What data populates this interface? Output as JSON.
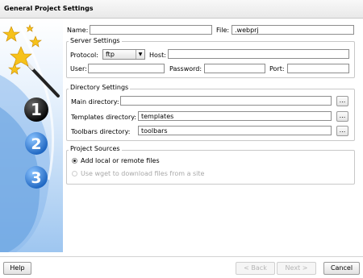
{
  "window": {
    "title": "General Project Settings"
  },
  "project": {
    "name_label": "Name:",
    "name_value": "",
    "file_label": "File:",
    "file_value": ".webprj"
  },
  "server": {
    "legend": "Server Settings",
    "protocol_label": "Protocol:",
    "protocol_value": "ftp",
    "host_label": "Host:",
    "host_value": "",
    "user_label": "User:",
    "user_value": "",
    "password_label": "Password:",
    "password_value": "",
    "port_label": "Port:",
    "port_value": ""
  },
  "directories": {
    "legend": "Directory Settings",
    "main_label": "Main directory:",
    "main_value": "",
    "templates_label": "Templates directory:",
    "templates_value": "templates",
    "toolbars_label": "Toolbars directory:",
    "toolbars_value": "toolbars",
    "browse_label": "..."
  },
  "sources": {
    "legend": "Project Sources",
    "option_local": "Add local or remote files",
    "option_wget": "Use wget to download files from a site"
  },
  "steps": [
    "1",
    "2",
    "3"
  ],
  "buttons": {
    "help": "Help",
    "back": "< Back",
    "next": "Next >",
    "cancel": "Cancel"
  },
  "colors": {
    "title_bg": "#eeeeee",
    "step_active": "#111111",
    "step_inactive": "#2f7fce",
    "panel_blue": "#6aa6e6"
  }
}
